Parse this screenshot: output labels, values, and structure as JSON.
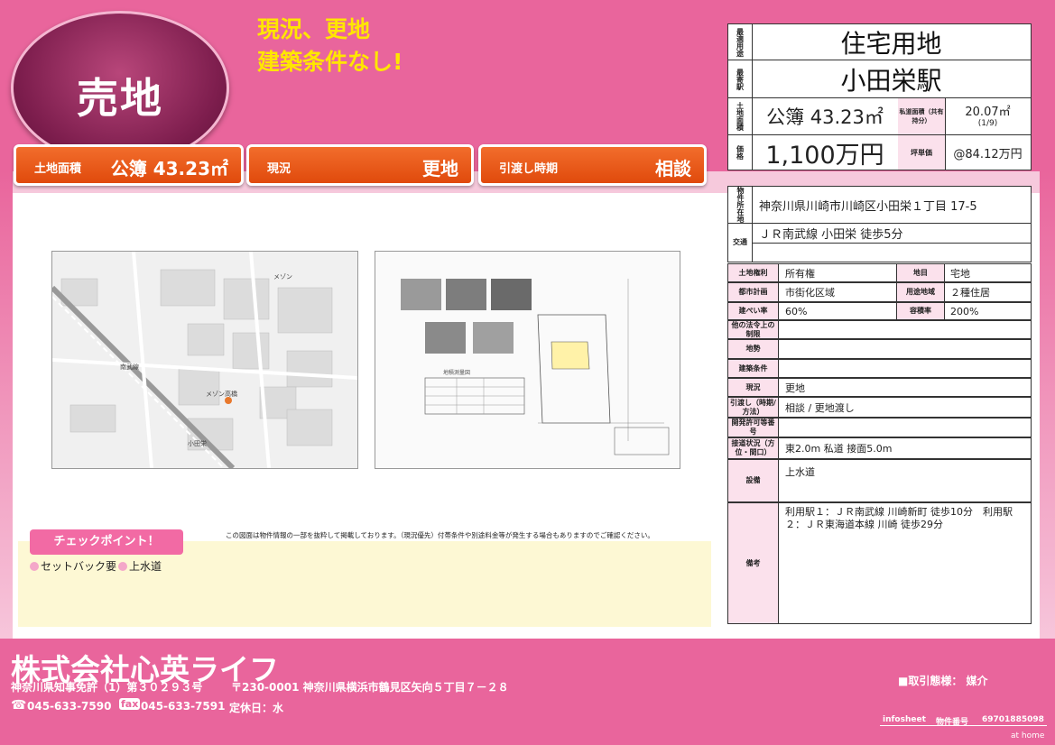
{
  "header": {
    "badge": "売地",
    "catch_line1": "現況、更地",
    "catch_line2": "建築条件なし!"
  },
  "tags": [
    {
      "key": "土地面積",
      "value": "公簿 43.23㎡"
    },
    {
      "key": "現況",
      "value": "更地"
    },
    {
      "key": "引渡し時期",
      "value": "相談"
    }
  ],
  "summary": {
    "use_label": "最適用途",
    "use_value": "住宅用地",
    "station_label": "最寄駅",
    "station_value": "小田栄駅",
    "area_label": "土地面積",
    "area_value": "公簿 43.23㎡",
    "private_road_label": "私道面積（共有持分）",
    "private_road_value": "20.07㎡",
    "private_road_share": "(1/9)",
    "price_label": "価格",
    "price_value": "1,100万円",
    "tsubo_label": "坪単価",
    "tsubo_value": "@84.12万円"
  },
  "details": {
    "address_label": "物件所在地",
    "address_value": "神奈川県川崎市川崎区小田栄１丁目 17-5",
    "transport_label": "交通",
    "transport_value": "ＪＲ南武線 小田栄 徒歩5分",
    "land_right_label": "土地権利",
    "land_right_value": "所有権",
    "chimoku_label": "地目",
    "chimoku_value": "宅地",
    "city_plan_label": "都市計画",
    "city_plan_value": "市街化区域",
    "zoning_label": "用途地域",
    "zoning_value": "２種住居",
    "bcr_label": "建ぺい率",
    "bcr_value": "60%",
    "far_label": "容積率",
    "far_value": "200%",
    "other_law_label": "他の法令上の制限",
    "terrain_label": "地勢",
    "building_cond_label": "建築条件",
    "status_label": "現況",
    "status_value": "更地",
    "handover_label": "引渡し（時期/方法）",
    "handover_value": "相談 / 更地渡し",
    "dev_permit_label": "開発許可等番号",
    "road_label": "接道状況（方位・間口）",
    "road_value": "東2.0m 私道 接面5.0m",
    "facility_label": "設備",
    "facility_value": "上水道",
    "remarks_label": "備考",
    "remarks_value": "利用駅１：ＪＲ南武線 川崎新町 徒歩10分　利用駅２：ＪＲ東海道本線 川崎 徒歩29分"
  },
  "images": {
    "map_labels": [
      "メゾン高橋",
      "小田栄",
      "南武線",
      "メゾン"
    ],
    "survey_caption": "地積測量図"
  },
  "disclaimer": "この図面は物件情報の一部を抜粋して掲載しております。（現況優先）付帯条件や別途料金等が発生する場合もありますのでご確認ください。",
  "checkpoint": {
    "title": "チェックポイント！",
    "items": [
      "セットバック要",
      "上水道"
    ]
  },
  "footer": {
    "company": "株式会社心英ライフ",
    "license": "神奈川県知事免許（1）第３０２９３号",
    "address": "〒230-0001 神奈川県横浜市鶴見区矢向５丁目７－２８",
    "tel_icon": "telephone-icon",
    "tel": "045-633-7590",
    "fax_label": "fax",
    "fax": "045-633-7591",
    "holiday": "定休日：水",
    "deal_type": "■取引態様： 媒介",
    "infosheet": "infosheet",
    "property_no_label": "物件番号",
    "property_no": "69701885098",
    "brand": "at home"
  }
}
